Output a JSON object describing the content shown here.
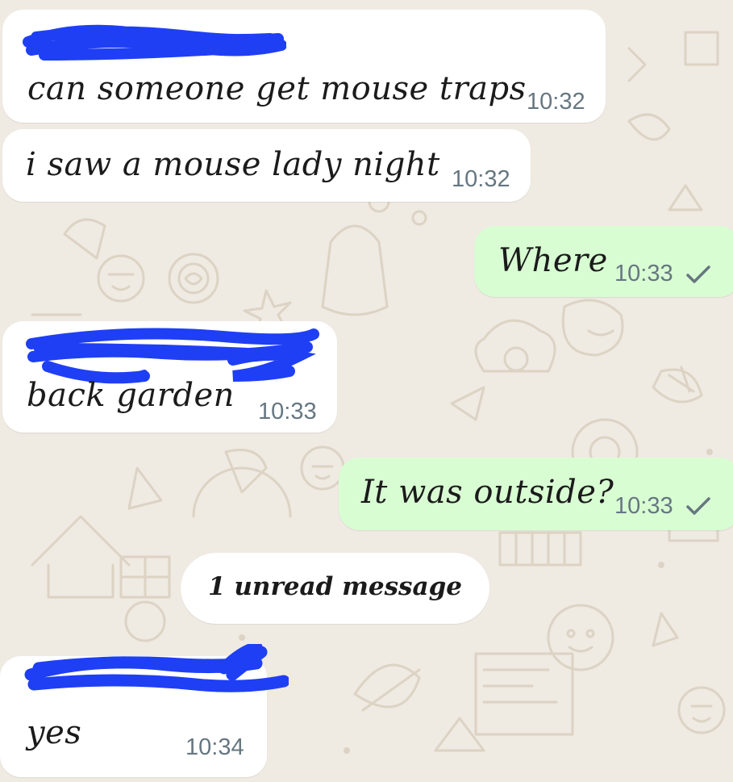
{
  "chat": {
    "messages": [
      {
        "direction": "incoming",
        "text": "can someone get mouse traps",
        "time": "10:32",
        "sender_redacted": true
      },
      {
        "direction": "incoming",
        "text": "i saw a mouse lady night",
        "time": "10:32"
      },
      {
        "direction": "outgoing",
        "text": "Where",
        "time": "10:33",
        "status_icon": "single-check-icon"
      },
      {
        "direction": "incoming",
        "text": "back garden",
        "time": "10:33",
        "sender_redacted": true
      },
      {
        "direction": "outgoing",
        "text": "It was outside?",
        "time": "10:33",
        "status_icon": "single-check-icon"
      },
      {
        "direction": "incoming",
        "text": "yes",
        "time": "10:34",
        "sender_redacted": true
      }
    ],
    "unread_divider": "1 unread message"
  },
  "colors": {
    "wallpaper": "#efeae2",
    "incoming_bubble": "#ffffff",
    "outgoing_bubble": "#d9fdd3",
    "timestamp": "#667781",
    "redaction_scribble": "#1f3ff5"
  }
}
